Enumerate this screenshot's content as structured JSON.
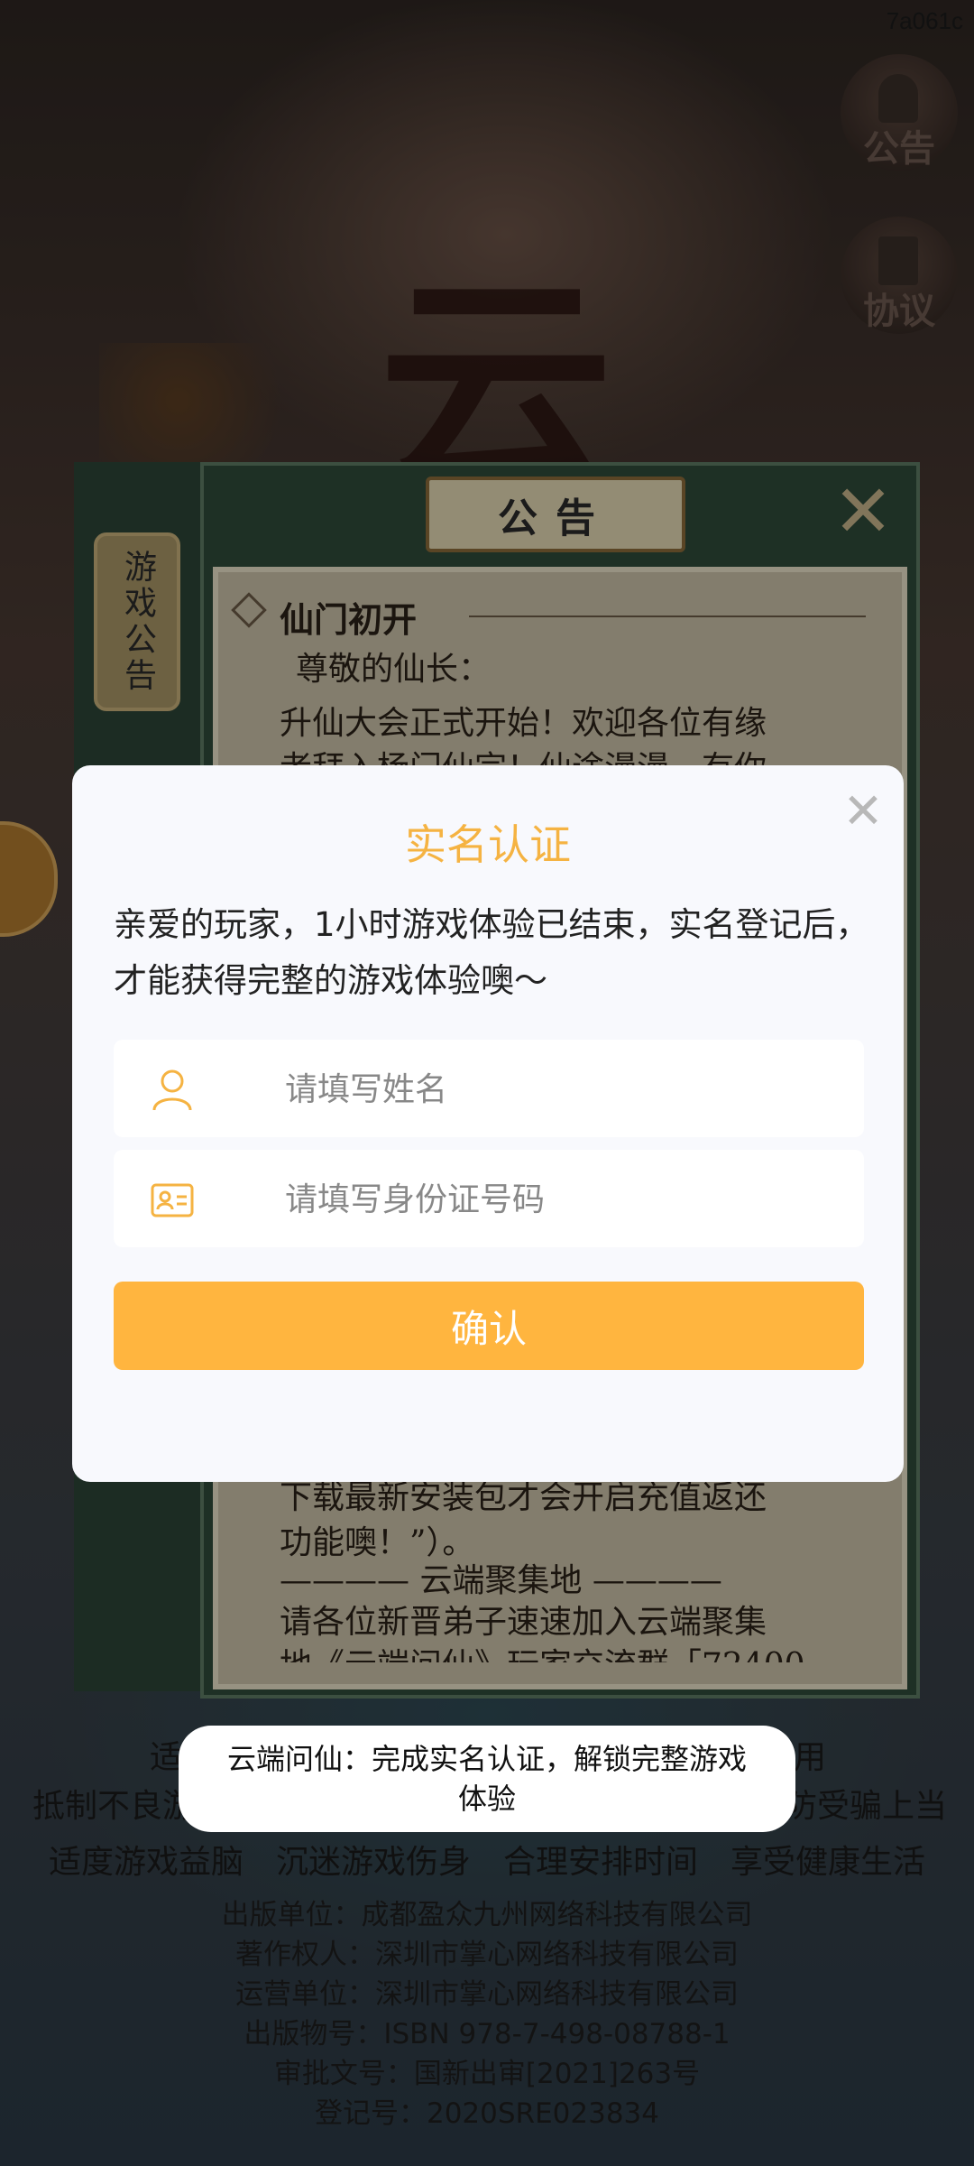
{
  "screen_id": "7a061c",
  "side_buttons": {
    "notice_label": "公告",
    "agreement_label": "协议"
  },
  "logo_char": "云",
  "notice": {
    "title": "公告",
    "side_tab": "游戏公告",
    "section_heading": "仙门初开",
    "greeting": "尊敬的仙长：",
    "para1_line1": "升仙大会正式开始！欢迎各位有缘",
    "para1_line2": "者拜入杨门仙宗！仙途漫漫，有你",
    "tail_line1": "下载最新安装包才会开启充值返还",
    "tail_line2": "功能噢！”）。",
    "section2": "———— 云端聚集地 ————",
    "section2_line1": "请各位新晋弟子速速加入云端聚集",
    "section2_line2": "地《云端问仙》玩家交流群「72400"
  },
  "modal": {
    "title": "实名认证",
    "message_line1": "亲爱的玩家，1小时游戏体验已结束，实名登记后，",
    "message_line2": "才能获得完整的游戏体验噢～",
    "name_placeholder": "请填写姓名",
    "id_placeholder": "请填写身份证号码",
    "confirm_label": "确认",
    "close_icon": "close-icon",
    "accent_color": "#f5b342",
    "button_color": "#ffb53f"
  },
  "toast": {
    "text": "云端问仙：完成实名认证，解锁完整游戏体验"
  },
  "health_notice": {
    "line1_left": "适",
    "line1_right": "用",
    "line2_left": "抵制不良游",
    "line2_right": "防受骗上当",
    "line3": "适度游戏益脑　沉迷游戏伤身　合理安排时间　享受健康生活"
  },
  "publisher": {
    "line1": "出版单位：成都盈众九州网络科技有限公司",
    "line2": "著作权人：深圳市掌心网络科技有限公司",
    "line3": "运营单位：深圳市掌心网络科技有限公司",
    "line4": "出版物号：ISBN 978-7-498-08788-1",
    "line5": "审批文号：国新出审[2021]263号",
    "line6": "登记号：2020SRE023834"
  }
}
